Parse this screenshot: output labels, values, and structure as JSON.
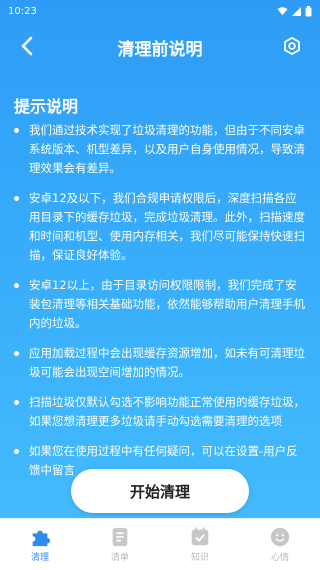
{
  "status_bar": {
    "time": "10:23"
  },
  "header": {
    "title": "清理前说明"
  },
  "section": {
    "title": "提示说明"
  },
  "tips": [
    "我们通过技术实现了垃圾清理的功能，但由于不同安卓系统版本、机型差异，以及用户自身使用情况，导致清理效果会有差异。",
    "安卓12及以下，我们合规申请权限后，深度扫描各应用目录下的缓存垃圾，完成垃圾清理。此外，扫描速度和时间和机型、使用内存相关，我们尽可能保持快速扫描，保证良好体验。",
    "安卓12以上，由于目录访问权限限制，我们完成了安装包清理等相关基础功能，依然能够帮助用户清理手机内的垃圾。",
    "应用加载过程中会出现缓存资源增加，如未有可清理垃圾可能会出现空间增加的情况。",
    "扫描垃圾仅默认勾选不影响功能正常使用的缓存垃圾，如果您想清理更多垃圾请手动勾选需要清理的选项",
    "如果您在使用过程中有任何疑问，可以在设置-用户反馈中留言"
  ],
  "start_button": {
    "label": "开始清理"
  },
  "tabs": [
    {
      "label": "清理",
      "icon": "puzzle-icon",
      "active": true
    },
    {
      "label": "清单",
      "icon": "list-icon",
      "active": false
    },
    {
      "label": "知识",
      "icon": "checkbox-icon",
      "active": false
    },
    {
      "label": "心情",
      "icon": "smiley-icon",
      "active": false
    }
  ],
  "colors": {
    "accent": "#2d8cf0",
    "background_top": "#2e9cf6",
    "background_bottom": "#46bdfd"
  }
}
